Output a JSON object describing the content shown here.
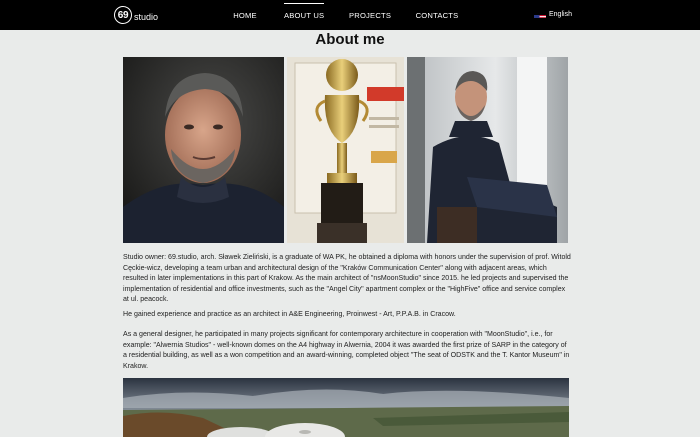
{
  "header": {
    "logo": {
      "number": "69",
      "text": "studio"
    },
    "nav": [
      {
        "label": "HOME"
      },
      {
        "label": "ABOUT US",
        "active": true
      },
      {
        "label": "PROJECTS"
      },
      {
        "label": "CONTACTS"
      }
    ],
    "language": {
      "label": "English",
      "flag_icon": "us-flag-icon"
    }
  },
  "main": {
    "title": "About me",
    "photos": [
      {
        "icon": "portrait-photo"
      },
      {
        "icon": "trophy-photo"
      },
      {
        "icon": "seated-portrait-photo"
      }
    ],
    "bio": [
      "Studio owner: 69.studio, arch. Sławek Zieliński, is a graduate of WA PK, he obtained a diploma with honors under the supervision of prof. Witold Cęckie-wicz, developing a team urban and architectural design of the \"Kraków Communication Center\" along with adjacent areas, which resulted in later implementations in this part of Krakow. As the main architect of \"nsMoonStudio\" since 2015. he led projects and supervised the implementation of residential and office investments, such as the \"Angel City\" apartment complex or the \"HighFive\" office and service complex at ul. peacock.",
      "He gained experience and practice as an architect in A&E Engineering, Proinwest - Art, P.P.A.B. in Cracow.",
      "As a general designer, he participated in many projects significant for contemporary architecture in cooperation with \"MoonStudio\", i.e., for example: \"Alwernia Studios\" - well-known domes on the A4 highway in Alwernia, 2004 it was awarded the first prize of SARP in the category of a residential building, as well as a won competition and an award-winning, completed object \"The seat of ODSTK and the T. Kantor Museum\" in Krakow."
    ],
    "bottom_photo": {
      "icon": "alwernia-domes-photo"
    }
  },
  "colors": {
    "header_bg": "#000000",
    "page_bg": "#e9ebea",
    "text": "#222222"
  }
}
